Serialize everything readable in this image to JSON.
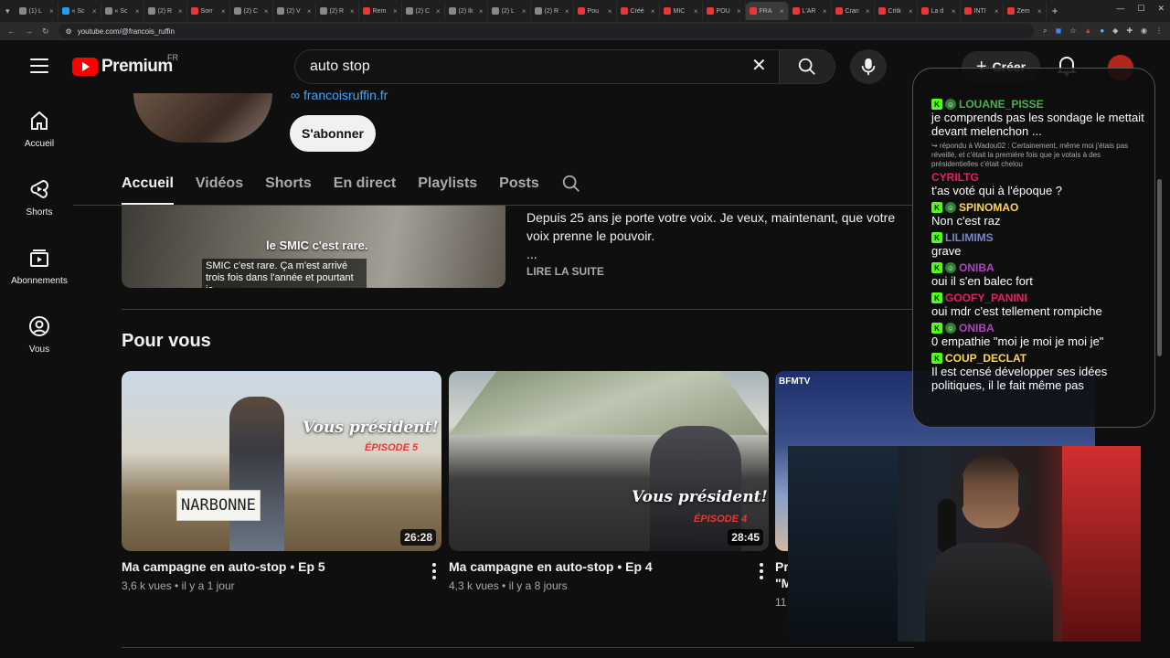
{
  "browser": {
    "tabs": [
      {
        "label": "(1) L",
        "color": "#888888"
      },
      {
        "label": "« Sc",
        "color": "#1da1f2"
      },
      {
        "label": "« Sc",
        "color": "#888888"
      },
      {
        "label": "(2) R",
        "color": "#888888"
      },
      {
        "label": "Sorr",
        "color": "#e53935"
      },
      {
        "label": "(2) C",
        "color": "#888888"
      },
      {
        "label": "(2) V",
        "color": "#888888"
      },
      {
        "label": "(2) R",
        "color": "#888888"
      },
      {
        "label": "Rem",
        "color": "#e53935"
      },
      {
        "label": "(2) C",
        "color": "#888888"
      },
      {
        "label": "(2) Ik",
        "color": "#888888"
      },
      {
        "label": "(2) L",
        "color": "#888888"
      },
      {
        "label": "(2) R",
        "color": "#888888"
      },
      {
        "label": "Pou",
        "color": "#e53935"
      },
      {
        "label": "Créé",
        "color": "#e53935"
      },
      {
        "label": "MIC",
        "color": "#e53935"
      },
      {
        "label": "POU",
        "color": "#e53935"
      },
      {
        "label": "FRA",
        "color": "#e53935"
      },
      {
        "label": "L'AR",
        "color": "#e53935"
      },
      {
        "label": "Cran",
        "color": "#e53935"
      },
      {
        "label": "Critk",
        "color": "#e53935"
      },
      {
        "label": "La d",
        "color": "#e53935"
      },
      {
        "label": "INTI",
        "color": "#e53935"
      },
      {
        "label": "Zem",
        "color": "#e53935"
      }
    ],
    "active_tab_index": 17,
    "url": "youtube.com/@francois_ruffin"
  },
  "header": {
    "logo_text": "Premium",
    "logo_country": "FR",
    "search_query": "auto stop",
    "create_label": "Créer"
  },
  "sidebar": {
    "items": [
      {
        "label": "Accueil",
        "icon": "home-icon"
      },
      {
        "label": "Shorts",
        "icon": "shorts-icon"
      },
      {
        "label": "Abonnements",
        "icon": "subscriptions-icon"
      },
      {
        "label": "Vous",
        "icon": "you-icon"
      }
    ]
  },
  "channel": {
    "link": "francoisruffin.fr",
    "subscribe_label": "S'abonner",
    "tabs": [
      "Accueil",
      "Vidéos",
      "Shorts",
      "En direct",
      "Playlists",
      "Posts"
    ],
    "active_tab": "Accueil"
  },
  "featured": {
    "overlay_title": "le SMIC c'est rare.",
    "overlay_subtitle": "SMIC c'est rare. Ça m'est arrivé trois fois dans l'année et pourtant je",
    "description": "Depuis 25 ans je porte votre voix. Je veux, maintenant, que votre voix prenne le pouvoir.",
    "ellipsis": "...",
    "read_more": "LIRE LA SUITE"
  },
  "for_you": {
    "title": "Pour vous",
    "videos": [
      {
        "title": "Ma campagne en auto-stop • Ep 5",
        "views": "3,6 k vues",
        "age": "il y a 1 jour",
        "duration": "26:28",
        "thumb_title": "Vous président!",
        "thumb_episode": "ÉPISODE 5",
        "sign": "NARBONNE"
      },
      {
        "title": "Ma campagne en auto-stop • Ep 4",
        "views": "4,3 k vues",
        "age": "il y a 8 jours",
        "duration": "28:45",
        "thumb_title": "Vous président!",
        "thumb_episode": "ÉPISODE 4"
      },
      {
        "title_start": "Pr",
        "title_line2": "\"M",
        "meta_start": "11",
        "thumb_brand": "BFMTV"
      }
    ]
  },
  "chat": {
    "messages": [
      {
        "user": "LOUANE_PISSE",
        "color": "#4caf50",
        "text": "je comprends pas les sondage le mettait devant melenchon ...",
        "badges": [
          "k",
          "g"
        ]
      },
      {
        "reply": "↪ répondu à Wadou02 : Certainement, même moi j'étais pas réveillé, et c'était la première fois que je votais à des présidentielles c'était chelou",
        "user": "CYRILTG",
        "color": "#e91e63",
        "text": "t'as voté qui à l'époque ?",
        "badges": []
      },
      {
        "user": "SPINOMAO",
        "color": "#ffd54f",
        "text": "Non c'est raz",
        "badges": [
          "k",
          "g"
        ]
      },
      {
        "user": "LILIMIMS",
        "color": "#7986cb",
        "text": "grave",
        "badges": [
          "k"
        ]
      },
      {
        "user": "ONIBA",
        "color": "#ab47bc",
        "text": "oui il s'en balec fort",
        "badges": [
          "k",
          "g"
        ]
      },
      {
        "user": "GOOFY_PANINI",
        "color": "#e91e63",
        "text": "oui mdr c'est tellement rompiche",
        "badges": [
          "k"
        ]
      },
      {
        "user": "ONIBA",
        "color": "#ab47bc",
        "text": "0 empathie \"moi je moi je moi je\"",
        "badges": [
          "k",
          "g"
        ]
      },
      {
        "user": "COUP_DECLAT",
        "color": "#ffd54f",
        "text": "Il est censé développer ses idées politiques, il le fait même pas",
        "badges": [
          "k"
        ]
      }
    ]
  },
  "colors": {
    "brand_red": "#ff0000",
    "link_blue": "#3ea6ff",
    "kick_green": "#53fc18"
  }
}
